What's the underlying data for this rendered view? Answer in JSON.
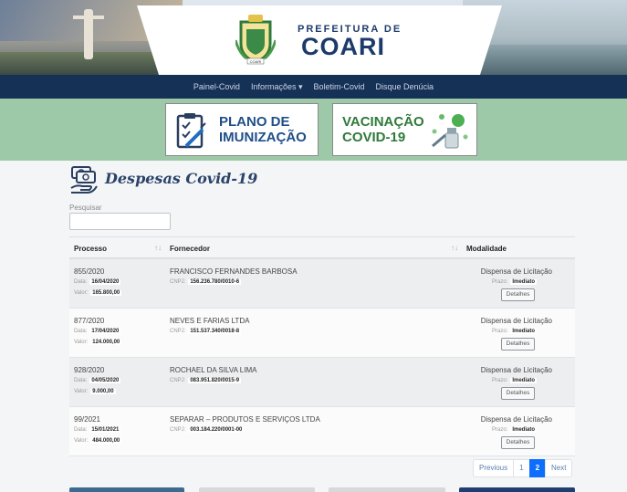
{
  "header": {
    "prefeitura_label": "PREFEITURA DE",
    "city": "COARI",
    "crest_text": "COARI"
  },
  "nav": {
    "items": [
      "Painel-Covid",
      "Informações",
      "Boletim-Covid",
      "Disque Denúcia"
    ],
    "dropdown_index": 1
  },
  "promos": {
    "plano": {
      "line1": "PLANO DE",
      "line2": "IMUNIZAÇÃO"
    },
    "vacinacao": {
      "line1": "VACINAÇÃO",
      "line2": "COVID-19"
    }
  },
  "page": {
    "title": "Despesas Covid-19",
    "search_label": "Pesquisar",
    "search_value": ""
  },
  "table": {
    "headers": [
      "Processo",
      "Fornecedor",
      "Modalidade"
    ],
    "data_label": "Data:",
    "valor_label": "Valor:",
    "cnpj_label": "CNPJ:",
    "prazo_label": "Prazo:",
    "details_label": "Detalhes",
    "rows": [
      {
        "processo": "855/2020",
        "data": "16/04/2020",
        "valor": "165.800,00",
        "fornecedor": "FRANCISCO FERNANDES BARBOSA",
        "cnpj": "156.236.780/0010-6",
        "modalidade": "Dispensa de Licitação",
        "prazo": "Imediato"
      },
      {
        "processo": "877/2020",
        "data": "17/04/2020",
        "valor": "124.000,00",
        "fornecedor": "NEVES E FARIAS LTDA",
        "cnpj": "151.537.340/0018-8",
        "modalidade": "Dispensa de Licitação",
        "prazo": "Imediato"
      },
      {
        "processo": "928/2020",
        "data": "04/05/2020",
        "valor": "9.000,00",
        "fornecedor": "ROCHAEL DA SILVA LIMA",
        "cnpj": "083.951.820/0015-9",
        "modalidade": "Dispensa de Licitação",
        "prazo": "Imediato"
      },
      {
        "processo": "99/2021",
        "data": "15/01/2021",
        "valor": "484.000,00",
        "fornecedor": "SEPARAR – PRODUTOS E SERVIÇOS LTDA",
        "cnpj": "003.184.220/0001-00",
        "modalidade": "Dispensa de Licitação",
        "prazo": "Imediato"
      }
    ]
  },
  "pagination": {
    "previous": "Previous",
    "pages": [
      "1",
      "2"
    ],
    "active": "2",
    "next": "Next"
  },
  "colors": {
    "navbar": "#163156",
    "banner": "#9ec9a8",
    "accent": "#0d6efd",
    "title": "#2a4368"
  }
}
